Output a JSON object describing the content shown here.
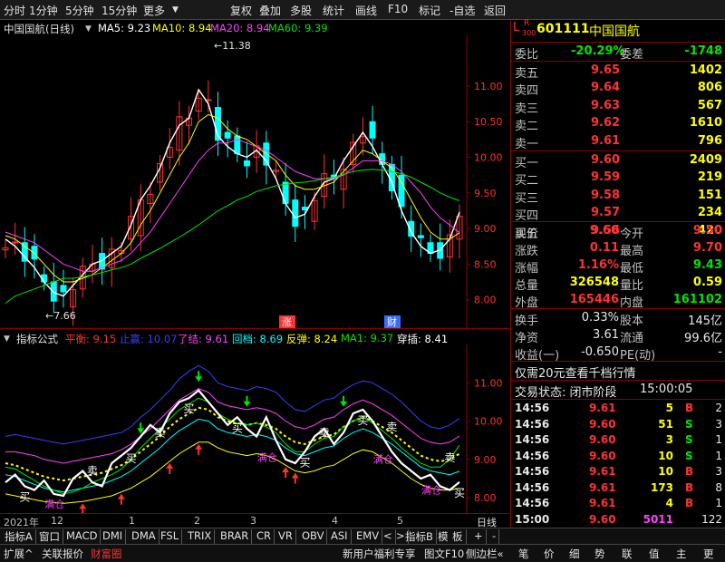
{
  "toolbar": {
    "left": [
      "分时",
      "1分钟",
      "5分钟",
      "15分钟",
      "更多"
    ],
    "right": [
      "复权",
      "叠加",
      "多股",
      "统计",
      "画线",
      "F10",
      "标记",
      "-自选",
      "返回"
    ]
  },
  "header": {
    "title": "中国国航(日线)",
    "ma": [
      {
        "label": "MA5: 9.23",
        "color": "#ffffff"
      },
      {
        "label": "MA10: 8.94",
        "color": "#ffff00"
      },
      {
        "label": "MA20: 8.94",
        "color": "#ff40ff"
      },
      {
        "label": "MA60: 9.39",
        "color": "#00e600"
      }
    ]
  },
  "chart_data": [
    {
      "type": "candlestick",
      "title": "中国国航(日线)",
      "ylim": [
        7.6,
        11.7
      ],
      "y_ticks": [
        "11.00",
        "10.50",
        "10.00",
        "9.50",
        "9.00",
        "8.50",
        "8.00"
      ],
      "annotations": {
        "high": "11.38",
        "low": "7.66",
        "rise_label": "涨",
        "finance_label": "财"
      },
      "x_labels": [
        "2021年",
        "12",
        "1",
        "2",
        "3",
        "4",
        "5"
      ],
      "series": [
        {
          "name": "MA5",
          "values": [
            8.85,
            8.75,
            8.6,
            8.45,
            8.25,
            8.1,
            8.05,
            8.2,
            8.35,
            8.5,
            8.55,
            8.65,
            8.75,
            9.05,
            9.4,
            9.6,
            9.85,
            10.2,
            10.45,
            10.55,
            10.95,
            10.75,
            10.3,
            10.15,
            10.05,
            10.0,
            10.1,
            9.95,
            9.7,
            9.35,
            9.15,
            9.2,
            9.45,
            9.65,
            9.7,
            9.95,
            10.15,
            10.35,
            10.15,
            9.9,
            9.65,
            9.25,
            8.95,
            8.75,
            8.65,
            8.7,
            8.85,
            9.23
          ]
        },
        {
          "name": "MA10",
          "values": [
            8.9,
            8.85,
            8.75,
            8.65,
            8.5,
            8.35,
            8.25,
            8.25,
            8.3,
            8.35,
            8.45,
            8.55,
            8.65,
            8.8,
            9.05,
            9.25,
            9.5,
            9.75,
            10.0,
            10.2,
            10.5,
            10.6,
            10.55,
            10.4,
            10.3,
            10.25,
            10.15,
            10.05,
            9.95,
            9.75,
            9.6,
            9.55,
            9.55,
            9.6,
            9.65,
            9.8,
            9.95,
            10.1,
            10.05,
            9.95,
            9.85,
            9.65,
            9.4,
            9.15,
            8.95,
            8.85,
            8.85,
            8.94
          ]
        },
        {
          "name": "MA20",
          "values": [
            8.95,
            8.9,
            8.85,
            8.8,
            8.7,
            8.6,
            8.5,
            8.45,
            8.4,
            8.4,
            8.45,
            8.5,
            8.55,
            8.65,
            8.8,
            8.95,
            9.15,
            9.35,
            9.55,
            9.75,
            9.95,
            10.1,
            10.2,
            10.2,
            10.25,
            10.2,
            10.15,
            10.1,
            10.0,
            9.9,
            9.8,
            9.75,
            9.7,
            9.7,
            9.7,
            9.75,
            9.85,
            9.95,
            9.95,
            9.95,
            9.9,
            9.8,
            9.65,
            9.5,
            9.3,
            9.15,
            9.05,
            8.94
          ]
        },
        {
          "name": "MA60",
          "values": [
            7.95,
            8.05,
            8.1,
            8.15,
            8.2,
            8.25,
            8.3,
            8.3,
            8.32,
            8.35,
            8.38,
            8.42,
            8.45,
            8.5,
            8.58,
            8.65,
            8.72,
            8.8,
            8.88,
            8.96,
            9.05,
            9.15,
            9.25,
            9.32,
            9.4,
            9.45,
            9.52,
            9.56,
            9.6,
            9.62,
            9.64,
            9.65,
            9.67,
            9.7,
            9.72,
            9.76,
            9.8,
            9.82,
            9.83,
            9.82,
            9.8,
            9.77,
            9.72,
            9.65,
            9.58,
            9.5,
            9.44,
            9.39
          ]
        }
      ]
    },
    {
      "type": "line",
      "title": "指标公式",
      "legend": [
        {
          "label": "平衡: 9.15",
          "color": "#ff3232"
        },
        {
          "label": "止赢: 10.07",
          "color": "#3c3cff"
        },
        {
          "label": "了结: 9.61",
          "color": "#ff40ff"
        },
        {
          "label": "回档: 8.69",
          "color": "#00ffff"
        },
        {
          "label": "反弹: 8.24",
          "color": "#ffff00"
        },
        {
          "label": "MA1: 9.37",
          "color": "#00e600"
        },
        {
          "label": "穿插: 8.41",
          "color": "#ffffff"
        }
      ],
      "ylim": [
        7.6,
        12.0
      ],
      "y_ticks": [
        "11.00",
        "10.00",
        "9.00",
        "8.00"
      ],
      "signals": {
        "buy": "买",
        "sell": "卖",
        "full": "满仓"
      },
      "series": [
        {
          "name": "止赢",
          "values": [
            9.6,
            9.65,
            9.6,
            9.55,
            9.5,
            9.45,
            9.4,
            9.45,
            9.5,
            9.55,
            9.6,
            9.65,
            9.7,
            9.85,
            10.1,
            10.3,
            10.55,
            10.8,
            11.1,
            11.3,
            11.45,
            11.3,
            11.0,
            10.9,
            10.85,
            10.8,
            10.9,
            10.85,
            10.75,
            10.5,
            10.3,
            10.25,
            10.4,
            10.55,
            10.6,
            10.8,
            10.95,
            11.05,
            11.0,
            10.85,
            10.7,
            10.5,
            10.25,
            10.0,
            9.85,
            9.8,
            9.9,
            10.07
          ]
        },
        {
          "name": "了结",
          "values": [
            9.2,
            9.2,
            9.15,
            9.1,
            9.0,
            8.95,
            8.9,
            8.95,
            9.0,
            9.05,
            9.1,
            9.15,
            9.25,
            9.4,
            9.6,
            9.8,
            10.05,
            10.3,
            10.55,
            10.7,
            10.85,
            10.75,
            10.5,
            10.4,
            10.35,
            10.3,
            10.35,
            10.3,
            10.2,
            10.0,
            9.85,
            9.8,
            9.9,
            10.05,
            10.1,
            10.3,
            10.45,
            10.55,
            10.45,
            10.3,
            10.15,
            9.95,
            9.75,
            9.55,
            9.45,
            9.4,
            9.45,
            9.61
          ]
        },
        {
          "name": "平衡",
          "values": [
            8.9,
            8.85,
            8.75,
            8.65,
            8.55,
            8.5,
            8.45,
            8.5,
            8.55,
            8.6,
            8.65,
            8.75,
            8.85,
            9.0,
            9.2,
            9.4,
            9.6,
            9.85,
            10.05,
            10.2,
            10.35,
            10.3,
            10.1,
            10.0,
            9.95,
            9.9,
            9.95,
            9.9,
            9.8,
            9.6,
            9.45,
            9.4,
            9.5,
            9.6,
            9.65,
            9.85,
            10.0,
            10.1,
            10.0,
            9.85,
            9.7,
            9.5,
            9.3,
            9.1,
            9.0,
            8.95,
            9.0,
            9.15
          ]
        },
        {
          "name": "回档",
          "values": [
            8.6,
            8.55,
            8.45,
            8.35,
            8.25,
            8.2,
            8.15,
            8.2,
            8.25,
            8.3,
            8.35,
            8.45,
            8.55,
            8.7,
            8.9,
            9.1,
            9.3,
            9.55,
            9.75,
            9.9,
            10.05,
            10.0,
            9.8,
            9.7,
            9.65,
            9.6,
            9.65,
            9.6,
            9.5,
            9.3,
            9.15,
            9.1,
            9.2,
            9.3,
            9.35,
            9.55,
            9.7,
            9.8,
            9.7,
            9.55,
            9.4,
            9.2,
            9.0,
            8.8,
            8.7,
            8.65,
            8.6,
            8.69
          ]
        },
        {
          "name": "反弹",
          "values": [
            8.1,
            8.05,
            8.0,
            7.95,
            7.9,
            7.88,
            7.85,
            7.88,
            7.9,
            7.95,
            8.0,
            8.05,
            8.15,
            8.25,
            8.4,
            8.55,
            8.75,
            8.95,
            9.15,
            9.3,
            9.45,
            9.45,
            9.3,
            9.2,
            9.15,
            9.1,
            9.15,
            9.1,
            9.0,
            8.85,
            8.7,
            8.65,
            8.7,
            8.8,
            8.85,
            9.0,
            9.15,
            9.25,
            9.2,
            9.05,
            8.9,
            8.7,
            8.5,
            8.35,
            8.25,
            8.2,
            8.2,
            8.24
          ]
        },
        {
          "name": "MA1",
          "values": [
            8.8,
            8.75,
            8.6,
            8.45,
            8.3,
            8.2,
            8.1,
            8.15,
            8.25,
            8.4,
            8.5,
            8.6,
            8.75,
            9.0,
            9.3,
            9.55,
            9.8,
            10.05,
            10.3,
            10.45,
            10.6,
            10.5,
            10.2,
            10.05,
            9.95,
            9.9,
            9.95,
            9.85,
            9.7,
            9.4,
            9.2,
            9.2,
            9.4,
            9.55,
            9.6,
            9.85,
            10.0,
            10.1,
            9.95,
            9.75,
            9.55,
            9.3,
            9.1,
            8.9,
            8.8,
            8.8,
            9.0,
            9.37
          ]
        },
        {
          "name": "穿插",
          "values": [
            8.4,
            8.6,
            8.3,
            8.2,
            8.45,
            8.1,
            8.05,
            8.5,
            8.7,
            8.4,
            8.3,
            8.9,
            9.1,
            9.3,
            9.6,
            9.9,
            9.7,
            10.2,
            10.5,
            10.6,
            10.8,
            10.5,
            10.2,
            9.9,
            10.1,
            9.8,
            9.6,
            10.1,
            9.5,
            9.0,
            8.9,
            9.2,
            9.6,
            9.8,
            9.4,
            9.7,
            10.2,
            10.3,
            10.0,
            9.6,
            9.2,
            8.9,
            8.7,
            8.5,
            8.6,
            8.3,
            8.2,
            8.41
          ]
        }
      ]
    }
  ],
  "quote": {
    "code": "601111",
    "name": "中国国航",
    "lr": "L",
    "r": "R",
    "r_sub": "300",
    "weibi_label": "委比",
    "weibi": "-20.29%",
    "weicha_label": "委差",
    "weicha": "-1748",
    "asks": [
      {
        "label": "卖五",
        "price": "9.65",
        "vol": "1402"
      },
      {
        "label": "卖四",
        "price": "9.64",
        "vol": "806"
      },
      {
        "label": "卖三",
        "price": "9.63",
        "vol": "567"
      },
      {
        "label": "卖二",
        "price": "9.62",
        "vol": "1610"
      },
      {
        "label": "卖一",
        "price": "9.61",
        "vol": "796"
      }
    ],
    "bids": [
      {
        "label": "买一",
        "price": "9.60",
        "vol": "2409"
      },
      {
        "label": "买二",
        "price": "9.59",
        "vol": "219"
      },
      {
        "label": "买三",
        "price": "9.58",
        "vol": "151"
      },
      {
        "label": "买四",
        "price": "9.57",
        "vol": "234"
      },
      {
        "label": "买五",
        "price": "9.56",
        "vol": "420"
      }
    ],
    "stats": [
      {
        "l1": "现价",
        "v1": "9.60",
        "c1": "red",
        "l2": "今开",
        "v2": "9.50",
        "c2": "red"
      },
      {
        "l1": "涨跌",
        "v1": "0.11",
        "c1": "red",
        "l2": "最高",
        "v2": "9.70",
        "c2": "red"
      },
      {
        "l1": "涨幅",
        "v1": "1.16%",
        "c1": "red",
        "l2": "最低",
        "v2": "9.43",
        "c2": "green"
      },
      {
        "l1": "总量",
        "v1": "326548",
        "c1": "yellow",
        "l2": "量比",
        "v2": "0.59",
        "c2": "yellow"
      },
      {
        "l1": "外盘",
        "v1": "165446",
        "c1": "red",
        "l2": "内盘",
        "v2": "161102",
        "c2": "green"
      }
    ],
    "stats2": [
      {
        "l1": "换手",
        "v1": "0.33%",
        "l2": "股本",
        "v2": "145亿"
      },
      {
        "l1": "净资",
        "v1": "3.61",
        "l2": "流通",
        "v2": "99.6亿"
      },
      {
        "l1": "收益(一)",
        "v1": "-0.650",
        "l2": "PE(动)",
        "v2": "-"
      }
    ],
    "promo": "仅需20元查看千档行情",
    "status_label": "交易状态: 闭市阶段",
    "status_time": "15:00:05",
    "ticks": [
      {
        "t": "14:56",
        "p": "9.61",
        "v": "5",
        "bs": "B",
        "n": "2"
      },
      {
        "t": "14:56",
        "p": "9.60",
        "v": "51",
        "bs": "S",
        "n": "3"
      },
      {
        "t": "14:56",
        "p": "9.60",
        "v": "3",
        "bs": "S",
        "n": "1"
      },
      {
        "t": "14:56",
        "p": "9.60",
        "v": "10",
        "bs": "S",
        "n": "1"
      },
      {
        "t": "14:56",
        "p": "9.61",
        "v": "10",
        "bs": "B",
        "n": "3"
      },
      {
        "t": "14:56",
        "p": "9.61",
        "v": "173",
        "bs": "B",
        "n": "8"
      },
      {
        "t": "14:56",
        "p": "9.61",
        "v": "4",
        "bs": "B",
        "n": "1"
      },
      {
        "t": "15:00",
        "p": "9.60",
        "v": "5011",
        "bs": "",
        "n": "122"
      }
    ]
  },
  "date_axis": {
    "labels": [
      "2021年",
      "12",
      "1",
      "2",
      "3",
      "4",
      "5"
    ],
    "right_label": "日线"
  },
  "tabs": [
    "指标A",
    "窗口",
    "MACD",
    "DMI",
    "DMA",
    "FSL",
    "TRIX",
    "BRAR",
    "CR",
    "VR",
    "OBV",
    "ASI",
    "EMV",
    "<",
    ">",
    "指标B",
    "模",
    "板",
    "+",
    "-"
  ],
  "bottom": {
    "left": [
      "扩展^",
      "关联报价",
      "财富圈"
    ],
    "promo": "新用户福利专享",
    "mid": [
      "图文F10",
      "侧边栏«"
    ],
    "right": [
      "笔",
      "价",
      "细",
      "势",
      "联",
      "值",
      "主",
      "更"
    ]
  }
}
